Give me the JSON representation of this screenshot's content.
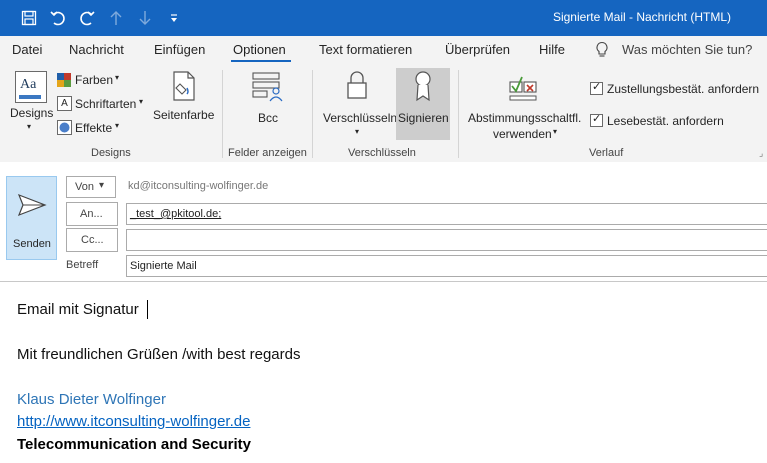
{
  "window": {
    "title": "Signierte Mail  -  Nachricht (HTML)"
  },
  "quick_access": {
    "save": "save-icon",
    "undo": "undo-icon",
    "redo": "redo-icon",
    "up": "arrow-up-icon",
    "down": "arrow-down-icon",
    "more": "customize-icon"
  },
  "tabs": [
    {
      "label": "Datei"
    },
    {
      "label": "Nachricht"
    },
    {
      "label": "Einfügen"
    },
    {
      "label": "Optionen"
    },
    {
      "label": "Text formatieren"
    },
    {
      "label": "Überprüfen"
    },
    {
      "label": "Hilfe"
    }
  ],
  "tell_me": "Was möchten Sie tun?",
  "ribbon": {
    "designs": {
      "label": "Designs",
      "farben": "Farben",
      "schriftarten": "Schriftarten",
      "effekte": "Effekte",
      "seitenfarbe": "Seitenfarbe",
      "group": "Designs"
    },
    "felder": {
      "bcc": "Bcc",
      "group": "Felder anzeigen"
    },
    "verschluesseln": {
      "encrypt": "Verschlüsseln",
      "sign": "Signieren",
      "group": "Verschlüsseln"
    },
    "verlauf": {
      "voting_line1": "Abstimmungsschaltfl.",
      "voting_line2": "verwenden",
      "delivery": "Zustellungsbestät. anfordern",
      "read": "Lesebestät. anfordern",
      "group": "Verlauf"
    }
  },
  "message": {
    "send": "Senden",
    "from_label": "Von",
    "from_value": "kd@itconsulting-wolfinger.de",
    "to_label": "An...",
    "to_value": "_test_@pkitool.de;",
    "cc_label": "Cc...",
    "cc_value": "",
    "subject_label": "Betreff",
    "subject_value": "Signierte Mail"
  },
  "body": {
    "line1": "Email mit Signatur",
    "line2": "Mit freundlichen Grüßen /with best regards",
    "name": "Klaus Dieter Wolfinger",
    "link": "http://www.itconsulting-wolfinger.de",
    "company": "Telecommunication and Security"
  },
  "colors": {
    "accent": "#1565c0",
    "link": "#0563c1",
    "name": "#2e75b6",
    "selected": "#cdcdcd"
  }
}
